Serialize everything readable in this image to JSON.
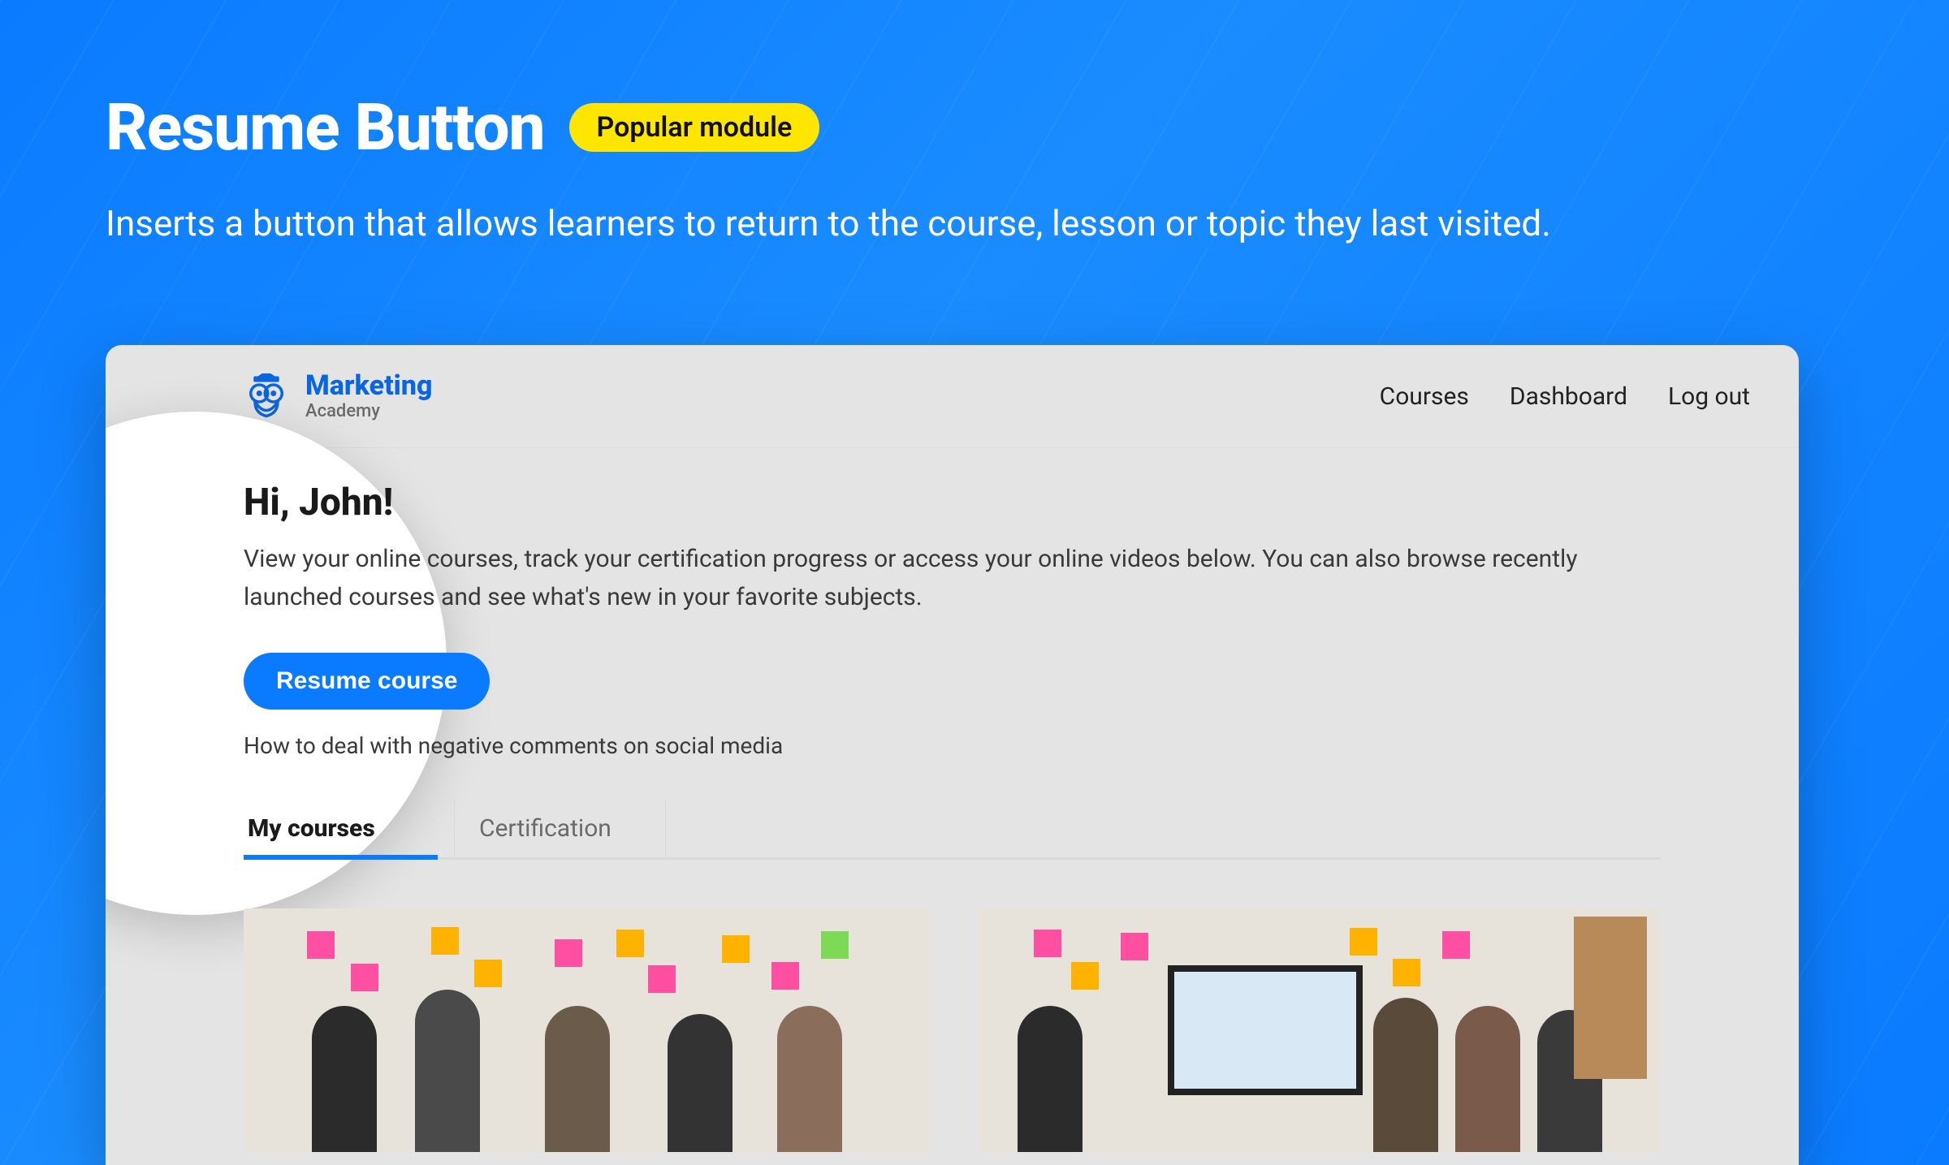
{
  "hero": {
    "title": "Resume Button",
    "badge": "Popular module",
    "subtitle": "Inserts a button that allows learners to return to the course, lesson or topic they last visited."
  },
  "brand": {
    "name": "Marketing",
    "subtitle": "Academy"
  },
  "nav": {
    "courses": "Courses",
    "dashboard": "Dashboard",
    "logout": "Log out"
  },
  "dashboard": {
    "greeting": "Hi, John!",
    "description": "View your online courses, track your certification progress or access your online videos below. You can also browse recently launched courses and see what's new in your favorite subjects.",
    "resume_label": "Resume course",
    "last_visited": "How to deal with negative comments on social media"
  },
  "tabs": {
    "my_courses": "My courses",
    "certification": "Certification"
  },
  "colors": {
    "accent": "#0a7bff",
    "badge_bg": "#ffe600"
  }
}
